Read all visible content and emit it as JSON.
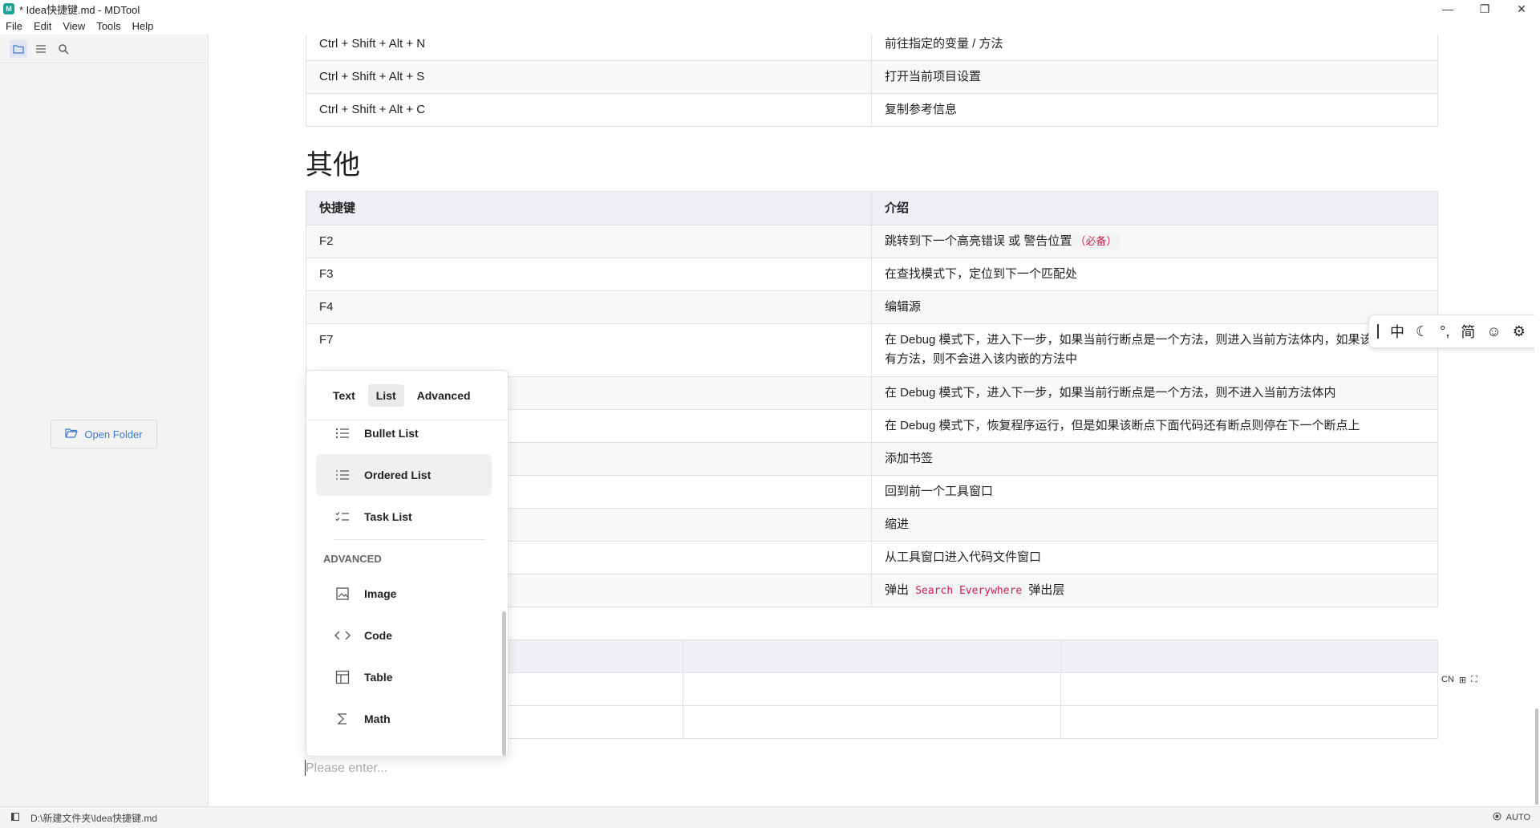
{
  "window": {
    "title": "* Idea快捷键.md - MDTool",
    "controls": {
      "minimize": "—",
      "maximize": "❐",
      "close": "✕"
    }
  },
  "menubar": {
    "items": [
      "File",
      "Edit",
      "View",
      "Tools",
      "Help"
    ]
  },
  "sidebar": {
    "tools": [
      "folder-icon",
      "outline-icon",
      "search-icon"
    ],
    "open_folder_label": "Open Folder"
  },
  "top_table": {
    "rows": [
      [
        "Ctrl + Shift + Alt + N",
        "前往指定的变量 / 方法"
      ],
      [
        "Ctrl + Shift + Alt + S",
        "打开当前项目设置"
      ],
      [
        "Ctrl + Shift + Alt + C",
        "复制参考信息"
      ]
    ]
  },
  "section": {
    "heading": "其他",
    "headers": [
      "快捷键",
      "介绍"
    ],
    "rows": [
      {
        "key": "F2",
        "desc": "跳转到下一个高亮错误 或 警告位置",
        "code": "（必备）"
      },
      {
        "key": "F3",
        "desc": "在查找模式下，定位到下一个匹配处",
        "code": ""
      },
      {
        "key": "F4",
        "desc": "编辑源",
        "code": ""
      },
      {
        "key": "F7",
        "desc": "在 Debug 模式下，进入下一步，如果当前行断点是一个方法，则进入当前方法体内，如果该方法体还有方法，则不会进入该内嵌的方法中",
        "code": ""
      },
      {
        "key": "",
        "desc": "在 Debug 模式下，进入下一步，如果当前行断点是一个方法，则不进入当前方法体内",
        "code": ""
      },
      {
        "key": "",
        "desc": "在 Debug 模式下，恢复程序运行，但是如果该断点下面代码还有断点则停在下一个断点上",
        "code": ""
      },
      {
        "key": "",
        "desc": "添加书签",
        "code": ""
      },
      {
        "key": "",
        "desc": "回到前一个工具窗口",
        "code": ""
      },
      {
        "key": "",
        "desc": "缩进",
        "code": ""
      },
      {
        "key": "",
        "desc": "从工具窗口进入代码文件窗口",
        "code": ""
      },
      {
        "key": "",
        "desc": "弹出",
        "code": "Search Everywhere",
        "desc_after": "弹出层"
      }
    ]
  },
  "editor": {
    "placeholder": "Please enter..."
  },
  "table_tools": [
    "CN",
    "⊞",
    "⛶"
  ],
  "popup": {
    "tabs": [
      "Text",
      "List",
      "Advanced"
    ],
    "active_tab": "List",
    "list_items": [
      {
        "label": "Bullet List",
        "icon": "bullet-list-icon"
      },
      {
        "label": "Ordered List",
        "icon": "ordered-list-icon"
      },
      {
        "label": "Task List",
        "icon": "task-list-icon"
      }
    ],
    "advanced_heading": "ADVANCED",
    "advanced_items": [
      {
        "label": "Image",
        "icon": "image-icon"
      },
      {
        "label": "Code",
        "icon": "code-icon"
      },
      {
        "label": "Table",
        "icon": "table-icon"
      },
      {
        "label": "Math",
        "icon": "sigma-icon"
      }
    ]
  },
  "ime": {
    "items": [
      "中",
      "☾",
      "°,",
      "简",
      "☺",
      "⚙"
    ]
  },
  "statusbar": {
    "path": "D:\\新建文件夹\\Idea快捷键.md",
    "mode": "AUTO"
  }
}
